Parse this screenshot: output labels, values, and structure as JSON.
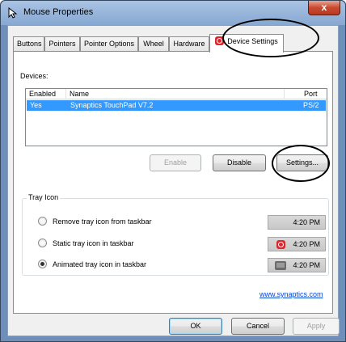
{
  "window": {
    "title": "Mouse Properties",
    "close_label": "x"
  },
  "tabs": [
    {
      "label": "Buttons"
    },
    {
      "label": "Pointers"
    },
    {
      "label": "Pointer Options"
    },
    {
      "label": "Wheel"
    },
    {
      "label": "Hardware"
    },
    {
      "label": "Device Settings",
      "active": true
    }
  ],
  "devices": {
    "label": "Devices:",
    "columns": [
      "Enabled",
      "Name",
      "Port"
    ],
    "rows": [
      {
        "enabled": "Yes",
        "name": "Synaptics TouchPad V7.2",
        "port": "PS/2",
        "selected": true
      }
    ]
  },
  "device_buttons": {
    "enable": "Enable",
    "disable": "Disable",
    "settings": "Settings..."
  },
  "tray_icon": {
    "group_title": "Tray Icon",
    "options": [
      {
        "label": "Remove tray icon from taskbar",
        "checked": false,
        "preview_time": "4:20 PM"
      },
      {
        "label": "Static tray icon in taskbar",
        "checked": false,
        "preview_time": "4:20 PM"
      },
      {
        "label": "Animated tray icon in taskbar",
        "checked": true,
        "preview_time": "4:20 PM"
      }
    ]
  },
  "link": {
    "text": "www.synaptics.com"
  },
  "footer": {
    "ok": "OK",
    "cancel": "Cancel",
    "apply": "Apply"
  },
  "colors": {
    "selection": "#3399ff",
    "accent_red": "#e0242c",
    "link": "#0645d8"
  }
}
